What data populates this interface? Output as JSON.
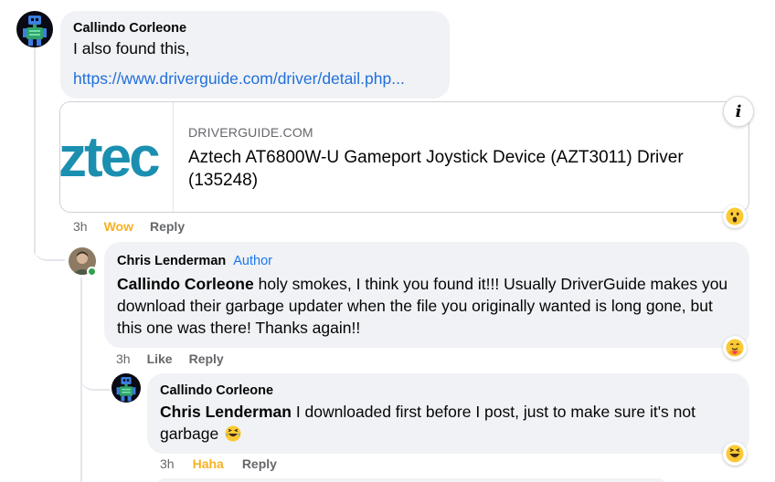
{
  "comments": [
    {
      "author": "Callindo Corleone",
      "text": "I also found this,",
      "link_text": "https://www.driverguide.com/driver/detail.php...",
      "link_preview": {
        "thumb_text": "ztec",
        "domain": "DRIVERGUIDE.COM",
        "title": "Aztech AT6800W-U Gameport Joystick Device (AZT3011) Driver (135248)"
      },
      "info_icon": "info-icon",
      "time": "3h",
      "reaction_label": "Wow",
      "reply_label": "Reply",
      "reaction_icon": "wow-emoji-icon",
      "reaction_color": "#f7b125"
    },
    {
      "author": "Chris Lenderman",
      "badge": "Author",
      "mention": "Callindo Corleone",
      "text": "holy smokes, I think you found it!!! Usually DriverGuide makes you download their garbage updater when the file you originally wanted is long gone, but this one was there! Thanks again!!",
      "time": "3h",
      "like_label": "Like",
      "reply_label": "Reply",
      "reaction_icon": "care-emoji-icon",
      "online_color": "#31a24c"
    },
    {
      "author": "Callindo Corleone",
      "mention": "Chris Lenderman",
      "text": "I downloaded first before I post, just to make sure it's not garbage",
      "inline_emoji": "laughing-emoji-icon",
      "time": "3h",
      "reaction_label": "Haha",
      "reply_label": "Reply",
      "reaction_icon": "haha-emoji-icon",
      "reaction_color": "#f7b125"
    }
  ],
  "colors": {
    "bubble": "#f0f2f5",
    "link": "#216fdb",
    "badge": "#1877f2",
    "muted": "#65676b"
  }
}
